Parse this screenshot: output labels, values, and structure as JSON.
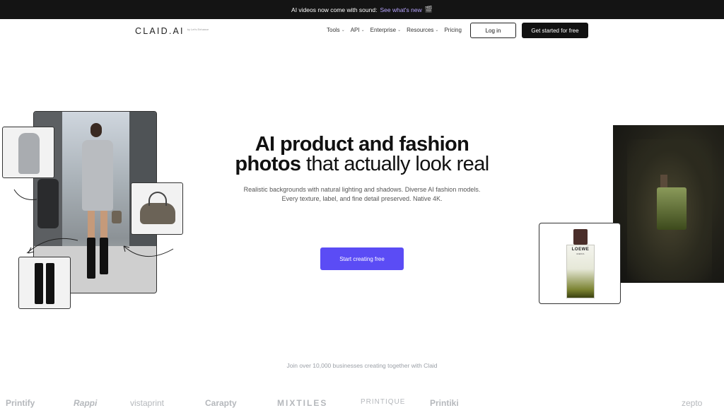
{
  "announcement": {
    "text": "AI videos now come with sound:",
    "link": "See what's new",
    "icon": "film-icon"
  },
  "nav": {
    "logo": "CLAID.AI",
    "logo_sub": "by Let's Enhance",
    "menu": [
      {
        "label": "Tools",
        "has_dropdown": true
      },
      {
        "label": "API",
        "has_dropdown": true
      },
      {
        "label": "Enterprise",
        "has_dropdown": true
      },
      {
        "label": "Resources",
        "has_dropdown": true
      },
      {
        "label": "Pricing",
        "has_dropdown": false
      }
    ],
    "login": "Log in",
    "cta": "Get started for free"
  },
  "hero": {
    "title_bold_1": "AI product and fashion",
    "title_bold_2": "photos",
    "title_rest": "that actually look real",
    "desc_line1": "Realistic backgrounds with natural lighting and shadows. Diverse AI fashion models.",
    "desc_line2": "Every texture, label, and fine detail preserved. Native 4K.",
    "cta": "Start creating free"
  },
  "perfume": {
    "brand": "LOEWE",
    "sub": "ESENCIA"
  },
  "social_proof": {
    "text": "Join over 10,000 businesses creating together with Claid",
    "logos": [
      "Printify",
      "Rappi",
      "vistaprint",
      "Carapty",
      "MIXTILES",
      "PRINTIQUE",
      "Printiki",
      "zepto"
    ]
  },
  "colors": {
    "accent": "#5b4cf5",
    "dark": "#111111",
    "announce_bg": "#141414",
    "link": "#b8a6ff"
  }
}
